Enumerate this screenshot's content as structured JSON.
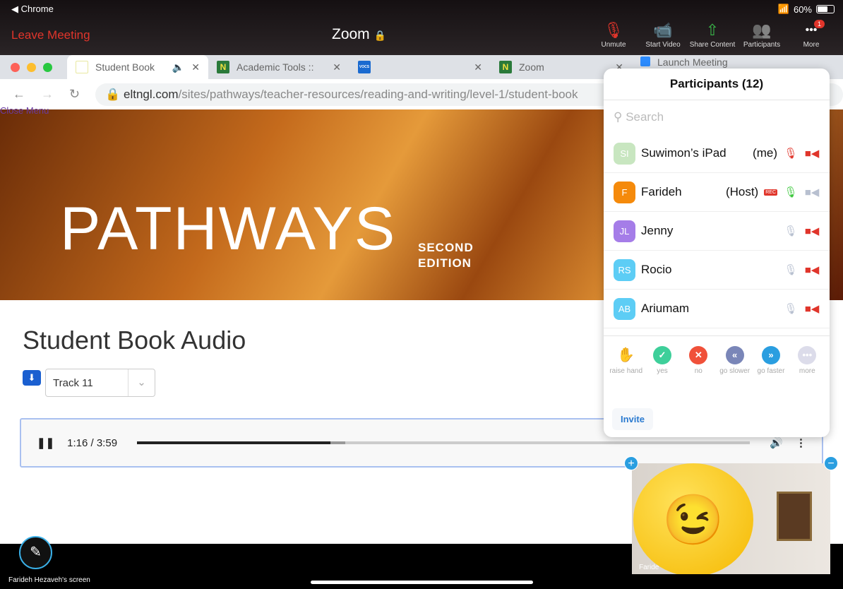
{
  "status": {
    "back_app": "Chrome",
    "battery": "60%",
    "battery_level": 0.6
  },
  "zoom": {
    "leave": "Leave Meeting",
    "title": "Zoom",
    "tools": [
      {
        "label": "Unmute",
        "icon": "🎙"
      },
      {
        "label": "Start Video",
        "icon": "📹"
      },
      {
        "label": "Share Content",
        "icon": "⇧"
      },
      {
        "label": "Participants",
        "icon": "👥"
      },
      {
        "label": "More",
        "icon": "•••",
        "badge": "1"
      }
    ]
  },
  "browser": {
    "tabs": [
      {
        "title": "Student Book",
        "fav": ""
      },
      {
        "title": "Academic Tools ::",
        "fav": "N"
      },
      {
        "title": "",
        "fav": "VOCS"
      },
      {
        "title": "Zoom",
        "fav": "N"
      },
      {
        "title": "Launch Meeting",
        "fav": ""
      }
    ],
    "url_domain": "eltngl.com",
    "url_path": "/sites/pathways/teacher-resources/reading-and-writing/level-1/student-book"
  },
  "page": {
    "menu": "Close Menu",
    "logo": "PATHWAYS",
    "edition_1": "SECOND",
    "edition_2": "EDITION",
    "heading": "Student Book Audio",
    "track": "Track 11",
    "time": "1:16 / 3:59",
    "progress": 0.315,
    "buffered": 0.34
  },
  "participants": {
    "title": "Participants (12)",
    "search_placeholder": "Search",
    "list": [
      {
        "initials": "SI",
        "name": "Suwimon’s iPad",
        "role": "(me)",
        "color": "#c8e6c0",
        "mic": "muted",
        "cam": "off"
      },
      {
        "initials": "F",
        "name": "Farideh",
        "role": "(Host)",
        "rec": "REC",
        "color": "#f58a0b",
        "mic": "on",
        "cam": "idle"
      },
      {
        "initials": "JL",
        "name": "Jenny",
        "role": "",
        "color": "#a57de8",
        "mic": "idle",
        "cam": "off"
      },
      {
        "initials": "RS",
        "name": "Rocio",
        "role": "",
        "color": "#5dcdf5",
        "mic": "idle",
        "cam": "off"
      },
      {
        "initials": "AB",
        "name": "Ariumam",
        "role": "",
        "color": "#5dcdf5",
        "mic": "idle",
        "cam": "off"
      }
    ],
    "reactions": [
      {
        "label": "raise hand",
        "icon": "✋",
        "color": "transparent"
      },
      {
        "label": "yes",
        "icon": "✓",
        "color": "#3ecf9a"
      },
      {
        "label": "no",
        "icon": "✕",
        "color": "#f0513a"
      },
      {
        "label": "go slower",
        "icon": "«",
        "color": "#7a86b8"
      },
      {
        "label": "go faster",
        "icon": "»",
        "color": "#2a9ee0"
      },
      {
        "label": "more",
        "icon": "•••",
        "color": "#dcdcea"
      }
    ],
    "invite": "Invite"
  },
  "video": {
    "name": "Faride",
    "plus": "+",
    "minus": "−",
    "emoji": "😉"
  },
  "screen_label": "Farideh Hezaveh's screen"
}
